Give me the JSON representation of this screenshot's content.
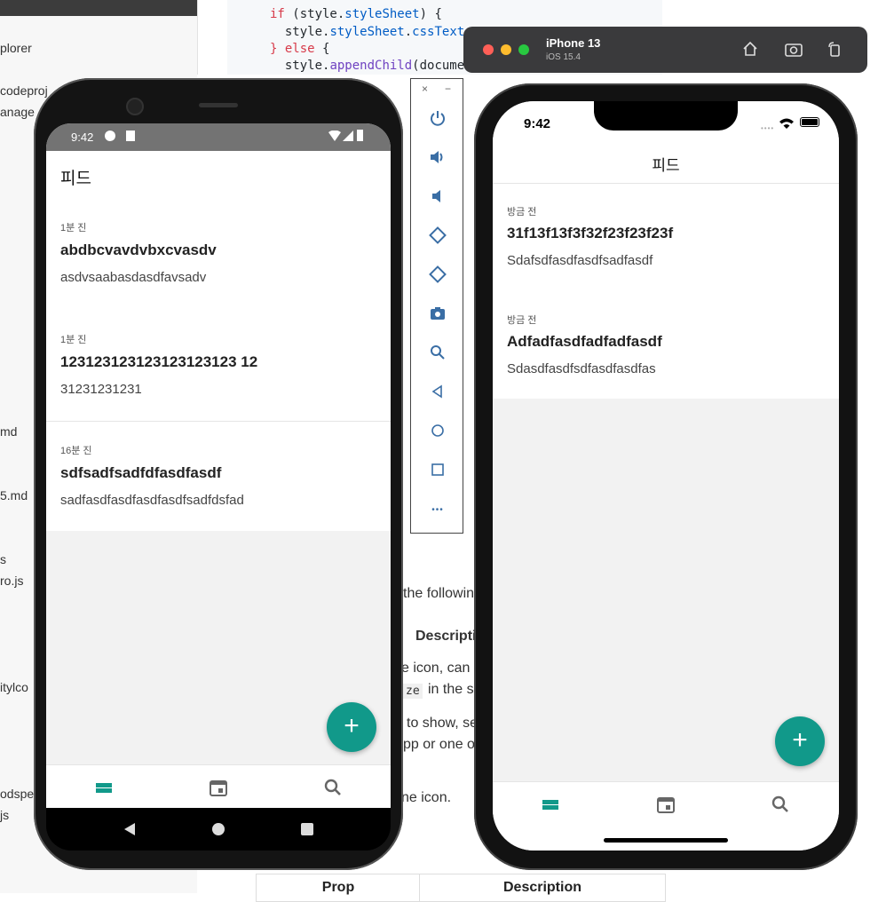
{
  "background": {
    "sidebar_items": [
      "plorer",
      "codeproj",
      "anage",
      "md",
      "5.md",
      "s",
      "ro.js",
      "itylco",
      "odspe",
      "js"
    ],
    "code_lines": [
      {
        "k1": "if",
        "rest1": " (style.",
        "p1": "styleSheet",
        "rest2": ") {"
      },
      {
        "rest1": "  style.",
        "p1": "styleSheet",
        "rest2": ".",
        "p2": "cssText"
      },
      {
        "k1": "} else",
        "rest1": " {"
      },
      {
        "rest1": "  style.",
        "f1": "appendChild",
        "rest2": "(documen"
      }
    ],
    "doc_fragments": [
      "the followin",
      "Descripti",
      "e icon, can a",
      "ze",
      "in the s",
      "to show, se",
      "pp or one o",
      "ne icon."
    ],
    "table_header": {
      "prop": "Prop",
      "description": "Description"
    }
  },
  "emulator_toolbar": {
    "close": "×",
    "minimize": "−",
    "buttons": [
      "power-icon",
      "volume-up-icon",
      "volume-down-icon",
      "rotate-left-icon",
      "rotate-right-icon",
      "camera-icon",
      "zoom-icon",
      "back-icon",
      "home-icon",
      "overview-icon",
      "more-icon"
    ],
    "more_glyph": "•••"
  },
  "android": {
    "status_time": "9:42",
    "header_title": "피드",
    "posts": [
      {
        "meta": "1분 진",
        "title": "abdbcvavdvbxcvasdv",
        "body": "asdvsaabasdasdfavsadv"
      },
      {
        "meta": "1분 진",
        "title": "123123123123123123123 12",
        "body": "31231231231"
      },
      {
        "meta": "16분 진",
        "title": "sdfsadfsadfdfasdfasdf",
        "body": "sadfasdfasdfasdfasdfsadfdsfad"
      }
    ],
    "fab_label": "+",
    "accent": "#11998a"
  },
  "ios": {
    "window_title": "iPhone 13",
    "window_subtitle": "iOS 15.4",
    "status_time": "9:42",
    "header_title": "피드",
    "posts": [
      {
        "meta": "방금 전",
        "title": "31f13f13f3f32f23f23f23f",
        "body": "Sdafsdfasdfasdfsadfasdf"
      },
      {
        "meta": "방금 전",
        "title": "Adfadfasdfadfadfasdf",
        "body": "Sdasdfasdfsdfasdfasdfas"
      }
    ],
    "fab_label": "+",
    "accent": "#11998a"
  }
}
